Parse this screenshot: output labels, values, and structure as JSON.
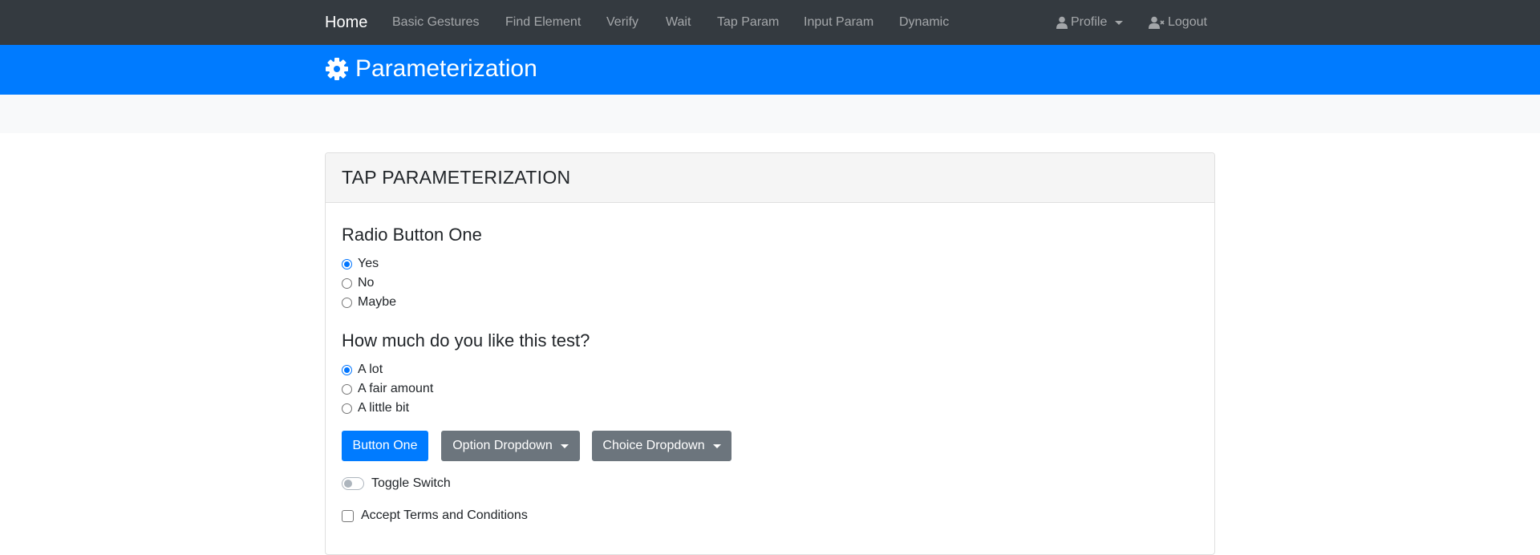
{
  "navbar": {
    "brand": "Home",
    "links": [
      "Basic Gestures",
      "Find Element",
      "Verify",
      "Wait",
      "Tap Param",
      "Input Param",
      "Dynamic"
    ],
    "profile": "Profile",
    "logout": "Logout"
  },
  "hero": {
    "title": "Parameterization",
    "icon": "gear-icon",
    "color": "#007bff"
  },
  "card": {
    "title": "TAP PARAMETERIZATION",
    "radio_group_one": {
      "title": "Radio Button One",
      "options": [
        "Yes",
        "No",
        "Maybe"
      ],
      "selected": "Yes"
    },
    "radio_group_two": {
      "title": "How much do you like this test?",
      "options": [
        "A lot",
        "A fair amount",
        "A little bit"
      ],
      "selected": "A lot"
    },
    "buttons": {
      "button_one": "Button One",
      "option_dropdown": "Option Dropdown",
      "choice_dropdown": "Choice Dropdown"
    },
    "toggle": {
      "label": "Toggle Switch",
      "on": false
    },
    "checkbox": {
      "label": "Accept Terms and Conditions",
      "checked": false
    }
  }
}
